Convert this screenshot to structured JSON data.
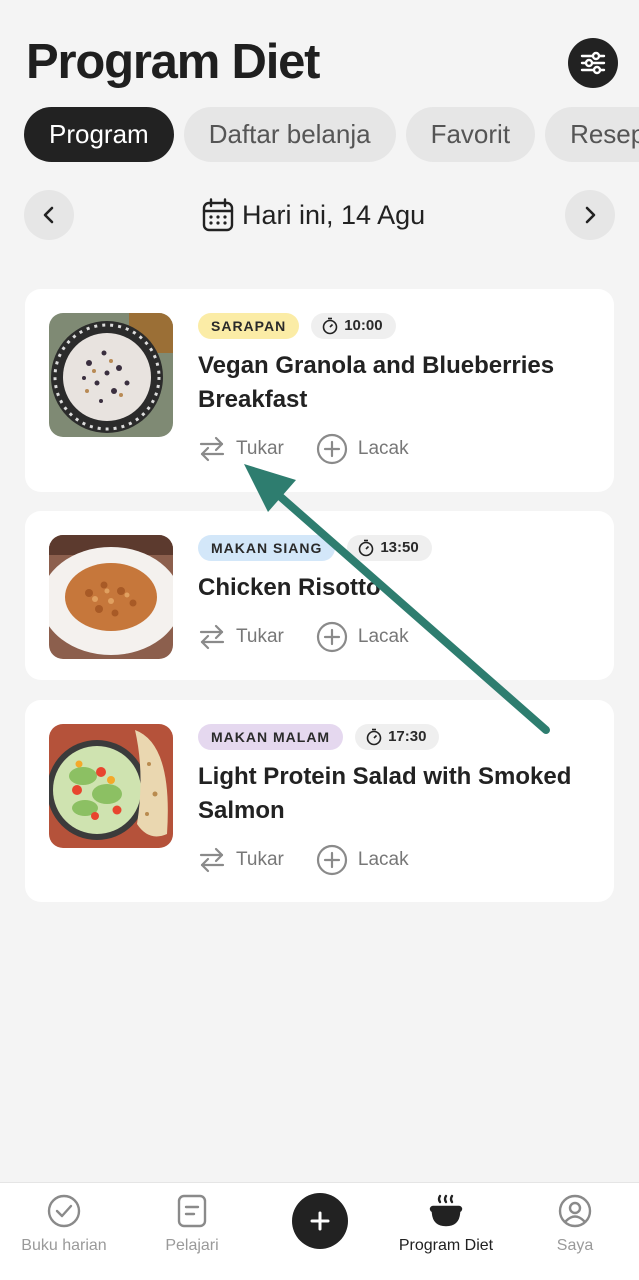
{
  "header": {
    "title": "Program Diet"
  },
  "tabs": [
    {
      "label": "Program",
      "active": true
    },
    {
      "label": "Daftar belanja",
      "active": false
    },
    {
      "label": "Favorit",
      "active": false
    },
    {
      "label": "Resep",
      "active": false
    }
  ],
  "date_nav": {
    "label": "Hari ini, 14 Agu"
  },
  "meals": [
    {
      "badge": "SARAPAN",
      "badge_color": "#fbeca6",
      "time": "10:00",
      "title": "Vegan Granola and Blueberries Breakfast",
      "swap_label": "Tukar",
      "track_label": "Lacak"
    },
    {
      "badge": "MAKAN SIANG",
      "badge_color": "#d3e7f9",
      "time": "13:50",
      "title": "Chicken Risotto",
      "swap_label": "Tukar",
      "track_label": "Lacak"
    },
    {
      "badge": "MAKAN MALAM",
      "badge_color": "#e5d8ef",
      "time": "17:30",
      "title": "Light Protein Salad with Smoked Salmon",
      "swap_label": "Tukar",
      "track_label": "Lacak"
    }
  ],
  "bottom_nav": {
    "items": [
      {
        "label": "Buku harian",
        "icon": "check-circle-icon"
      },
      {
        "label": "Pelajari",
        "icon": "document-icon"
      },
      {
        "label": "Program Diet",
        "icon": "bowl-icon",
        "active": true
      },
      {
        "label": "Saya",
        "icon": "user-circle-icon"
      }
    ],
    "add_icon": "plus-icon"
  },
  "colors": {
    "accent_dark": "#222222",
    "annotation_arrow": "#2e7d6f"
  }
}
